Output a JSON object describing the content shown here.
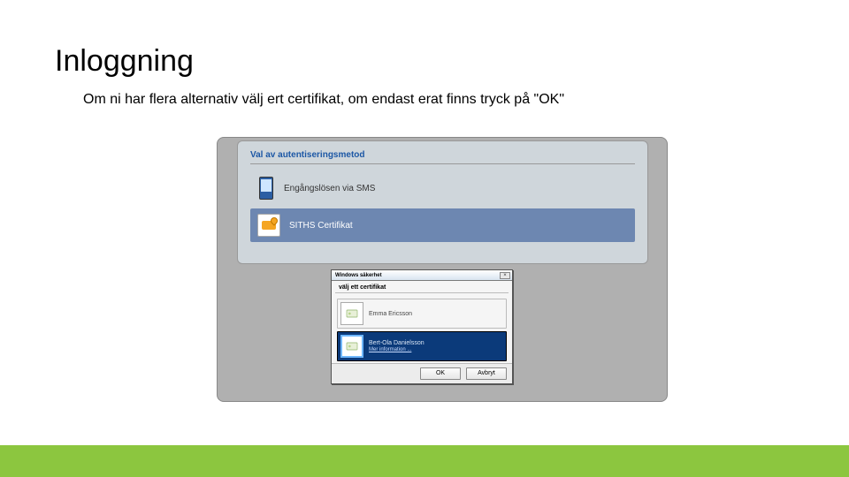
{
  "slide": {
    "title": "Inloggning",
    "subheading": "Om ni har flera alternativ välj ert certifikat, om endast erat finns tryck på \"OK\""
  },
  "auth_panel": {
    "heading": "Val av autentiseringsmetod",
    "options": [
      {
        "label": "Engångslösen via SMS"
      },
      {
        "label": "SITHS Certifikat"
      }
    ]
  },
  "dialog": {
    "title": "Windows säkerhet",
    "subtitle": "välj ett certifikat",
    "certs": [
      {
        "name": "Emma Ericsson"
      },
      {
        "name": "Bert-Ola Danielsson",
        "more": "Mer information ..."
      }
    ],
    "buttons": {
      "ok": "OK",
      "cancel": "Avbryt"
    },
    "close": "×"
  }
}
